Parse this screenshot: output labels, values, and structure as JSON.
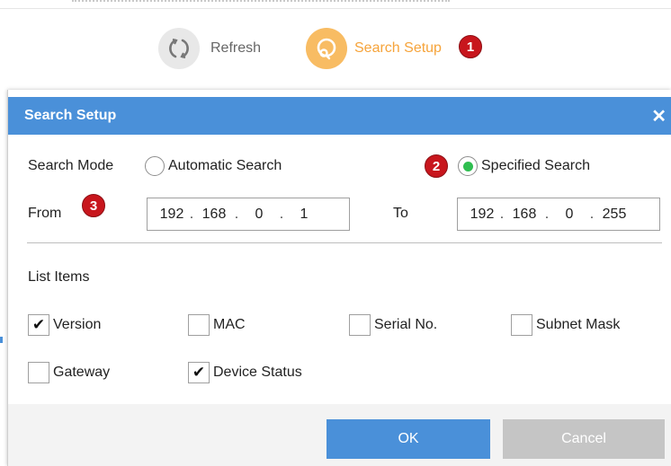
{
  "toolbar": {
    "refresh_label": "Refresh",
    "search_setup_label": "Search Setup"
  },
  "badges": {
    "b1": "1",
    "b2": "2",
    "b3": "3"
  },
  "dialog": {
    "title": "Search Setup",
    "close_glyph": "✕",
    "search_mode": {
      "label": "Search Mode",
      "options": [
        {
          "label": "Automatic Search",
          "selected": false
        },
        {
          "label": "Specified Search",
          "selected": true
        }
      ]
    },
    "range": {
      "from_label": "From",
      "to_label": "To",
      "from_ip": [
        "192",
        "168",
        "0",
        "1"
      ],
      "to_ip": [
        "192",
        "168",
        "0",
        "255"
      ]
    },
    "list_items": {
      "label": "List Items",
      "items": [
        {
          "label": "Version",
          "checked": true
        },
        {
          "label": "MAC",
          "checked": false
        },
        {
          "label": "Serial No.",
          "checked": false
        },
        {
          "label": "Subnet Mask",
          "checked": false
        },
        {
          "label": "Gateway",
          "checked": false
        },
        {
          "label": "Device Status",
          "checked": true
        }
      ]
    },
    "ok_label": "OK",
    "cancel_label": "Cancel"
  },
  "colors": {
    "header_blue": "#4a90d9",
    "accent_orange": "#f6a43b",
    "badge_red": "#c8161d",
    "radio_green": "#2fbe50"
  },
  "icons": {
    "refresh": "refresh-icon",
    "search_setup": "search-setup-icon",
    "close": "close-icon",
    "check": "check-icon"
  }
}
